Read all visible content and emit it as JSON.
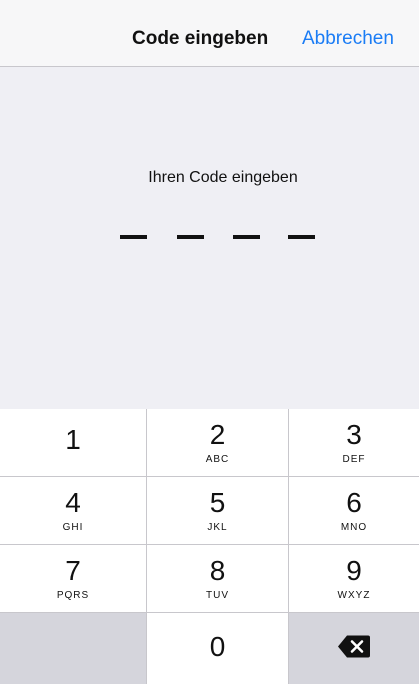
{
  "nav": {
    "title": "Code eingeben",
    "cancel": "Abbrechen"
  },
  "entry": {
    "prompt": "Ihren Code eingeben",
    "entered_digits": 0,
    "code_length": 4
  },
  "keypad": {
    "keys": [
      {
        "digit": "1",
        "letters": ""
      },
      {
        "digit": "2",
        "letters": "ABC"
      },
      {
        "digit": "3",
        "letters": "DEF"
      },
      {
        "digit": "4",
        "letters": "GHI"
      },
      {
        "digit": "5",
        "letters": "JKL"
      },
      {
        "digit": "6",
        "letters": "MNO"
      },
      {
        "digit": "7",
        "letters": "PQRS"
      },
      {
        "digit": "8",
        "letters": "TUV"
      },
      {
        "digit": "9",
        "letters": "WXYZ"
      },
      {
        "digit": "0",
        "letters": ""
      }
    ],
    "delete_icon": "backspace-icon"
  },
  "colors": {
    "accent": "#1a7cf5",
    "entry_background": "#efeff4",
    "key_background": "#ffffff",
    "function_key_background": "#d5d5dc",
    "separator": "#c8c7cc"
  }
}
